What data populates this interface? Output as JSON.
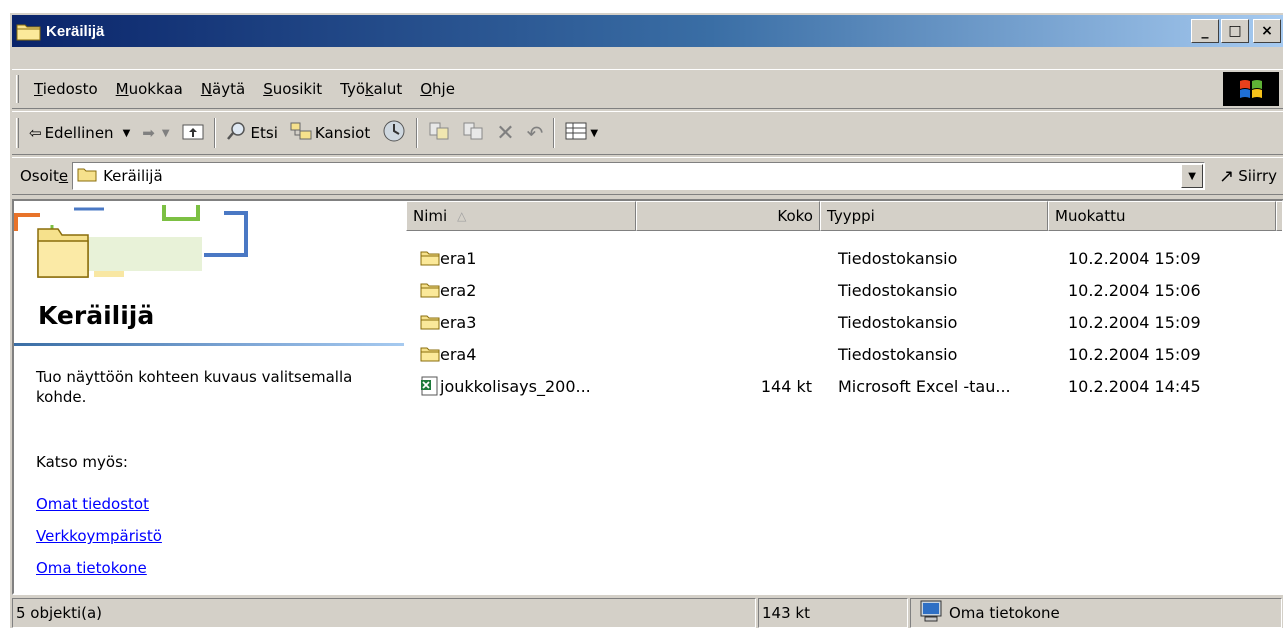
{
  "window": {
    "title": "Keräilijä",
    "buttons": {
      "minimize": "_",
      "maximize": "□",
      "close": "×"
    }
  },
  "menu": [
    {
      "pre": "",
      "u": "T",
      "post": "iedosto"
    },
    {
      "pre": "",
      "u": "M",
      "post": "uokkaa"
    },
    {
      "pre": "",
      "u": "N",
      "post": "äytä"
    },
    {
      "pre": "",
      "u": "S",
      "post": "uosikit"
    },
    {
      "pre": "Työ",
      "u": "k",
      "post": "alut"
    },
    {
      "pre": "",
      "u": "O",
      "post": "hje"
    }
  ],
  "toolbar": {
    "back_label": "Edellinen",
    "search_label": "Etsi",
    "folders_label": "Kansiot"
  },
  "address": {
    "label_pre": "Osoit",
    "label_u": "e",
    "value": "Keräilijä",
    "go_label": "Siirry"
  },
  "left_pane": {
    "heading": "Keräilijä",
    "description": "Tuo näyttöön kohteen kuvaus valitsemalla kohde.",
    "see_also": "Katso myös:",
    "links": [
      "Omat tiedostot",
      "Verkkoympäristö",
      "Oma tietokone"
    ]
  },
  "columns": {
    "name": "Nimi",
    "size": "Koko",
    "type": "Tyyppi",
    "modified": "Muokattu"
  },
  "files": [
    {
      "name": "era1",
      "size": "",
      "type": "Tiedostokansio",
      "modified": "10.2.2004 15:09",
      "icon": "folder-icon"
    },
    {
      "name": "era2",
      "size": "",
      "type": "Tiedostokansio",
      "modified": "10.2.2004 15:06",
      "icon": "folder-icon"
    },
    {
      "name": "era3",
      "size": "",
      "type": "Tiedostokansio",
      "modified": "10.2.2004 15:09",
      "icon": "folder-icon"
    },
    {
      "name": "era4",
      "size": "",
      "type": "Tiedostokansio",
      "modified": "10.2.2004 15:09",
      "icon": "folder-icon"
    },
    {
      "name": "joukkolisays_200...",
      "size": "144 kt",
      "type": "Microsoft Excel -tau...",
      "modified": "10.2.2004 14:45",
      "icon": "excel-file-icon"
    }
  ],
  "status": {
    "objects": "5 objekti(a)",
    "size": "143 kt",
    "zone": "Oma tietokone"
  },
  "colors": {
    "titlebar_start": "#0a246a",
    "titlebar_end": "#a6caf0",
    "face": "#d4d0c8",
    "link": "#0000ff",
    "folder": "#f6e18c"
  }
}
